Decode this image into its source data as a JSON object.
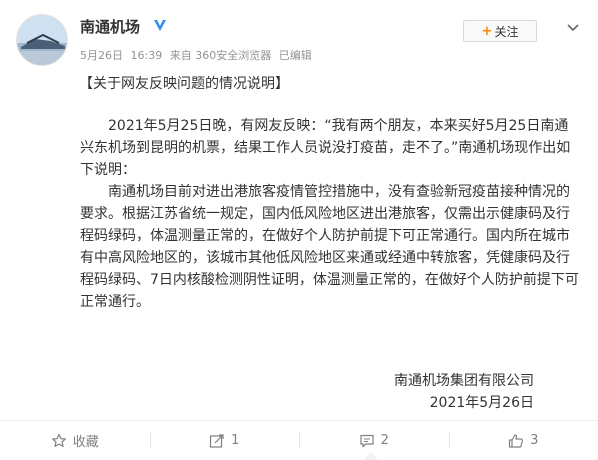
{
  "author": {
    "name": "南通机场",
    "verified": true
  },
  "meta": {
    "date": "5月26日",
    "time": "16:39",
    "source": "来自 360安全浏览器",
    "edited": "已编辑"
  },
  "follow_label": "关注",
  "headline": "【关于网友反映问题的情况说明】",
  "paragraphs": [
    "2021年5月25日晚，有网友反映：“我有两个朋友，本来买好5月25日南通兴东机场到昆明的机票，结果工作人员说没打疫苗，走不了。”南通机场现作出如下说明：",
    "南通机场目前对进出港旅客疫情管控措施中，没有查验新冠疫苗接种情况的要求。根据江苏省统一规定，国内低风险地区进出港旅客，仅需出示健康码及行程码绿码，体温测量正常的，在做好个人防护前提下可正常通行。国内所在城市有中高风险地区的，该城市其他低风险地区来通或经通中转旅客，凭健康码及行程码绿码、7日内核酸检测阴性证明，体温测量正常的，在做好个人防护前提下可正常通行。"
  ],
  "signature": {
    "org": "南通机场集团有限公司",
    "date": "2021年5月26日"
  },
  "actions": {
    "favorite_label": "收藏",
    "repost_count": "1",
    "comment_count": "2",
    "like_count": "3"
  },
  "colors": {
    "accent": "#ff8200",
    "verified": "#2c8cf0",
    "meta_text": "#939393"
  },
  "icons": [
    "avatar-image",
    "verified-icon",
    "chevron-down-icon",
    "star-icon",
    "repost-icon",
    "comment-icon",
    "like-icon"
  ]
}
